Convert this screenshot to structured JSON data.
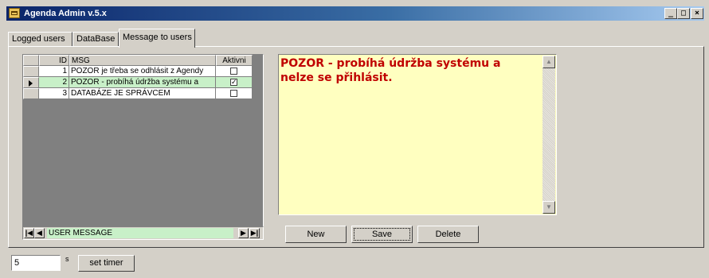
{
  "window": {
    "title": "Agenda Admin v.5.x",
    "controls": {
      "minimize": "_",
      "maximize": "□",
      "close": "×"
    }
  },
  "tabs": [
    {
      "label": "Logged users"
    },
    {
      "label": "DataBase"
    },
    {
      "label": "Message to users"
    }
  ],
  "grid": {
    "columns": {
      "id": "ID",
      "msg": "MSG",
      "active": "Aktivni"
    },
    "rows": [
      {
        "id": "1",
        "msg": "POZOR je třeba se odhlásit z Agendy",
        "active": false
      },
      {
        "id": "2",
        "msg": "POZOR - probíhá údržba systému a",
        "active": true
      },
      {
        "id": "3",
        "msg": "DATABÁZE JE SPRÁVCEM",
        "active": false
      }
    ],
    "selected_row": 2
  },
  "navigator": {
    "label": "USER MESSAGE",
    "first": "|◀",
    "prior": "◀",
    "next": "▶",
    "last": "▶|"
  },
  "memo": {
    "text": "POZOR - probíhá údržba systému a\nnelze se přihlásit."
  },
  "buttons": {
    "new": "New",
    "save": "Save",
    "delete": "Delete",
    "set_timer": "set timer"
  },
  "timer": {
    "value": "5",
    "unit": "s"
  }
}
